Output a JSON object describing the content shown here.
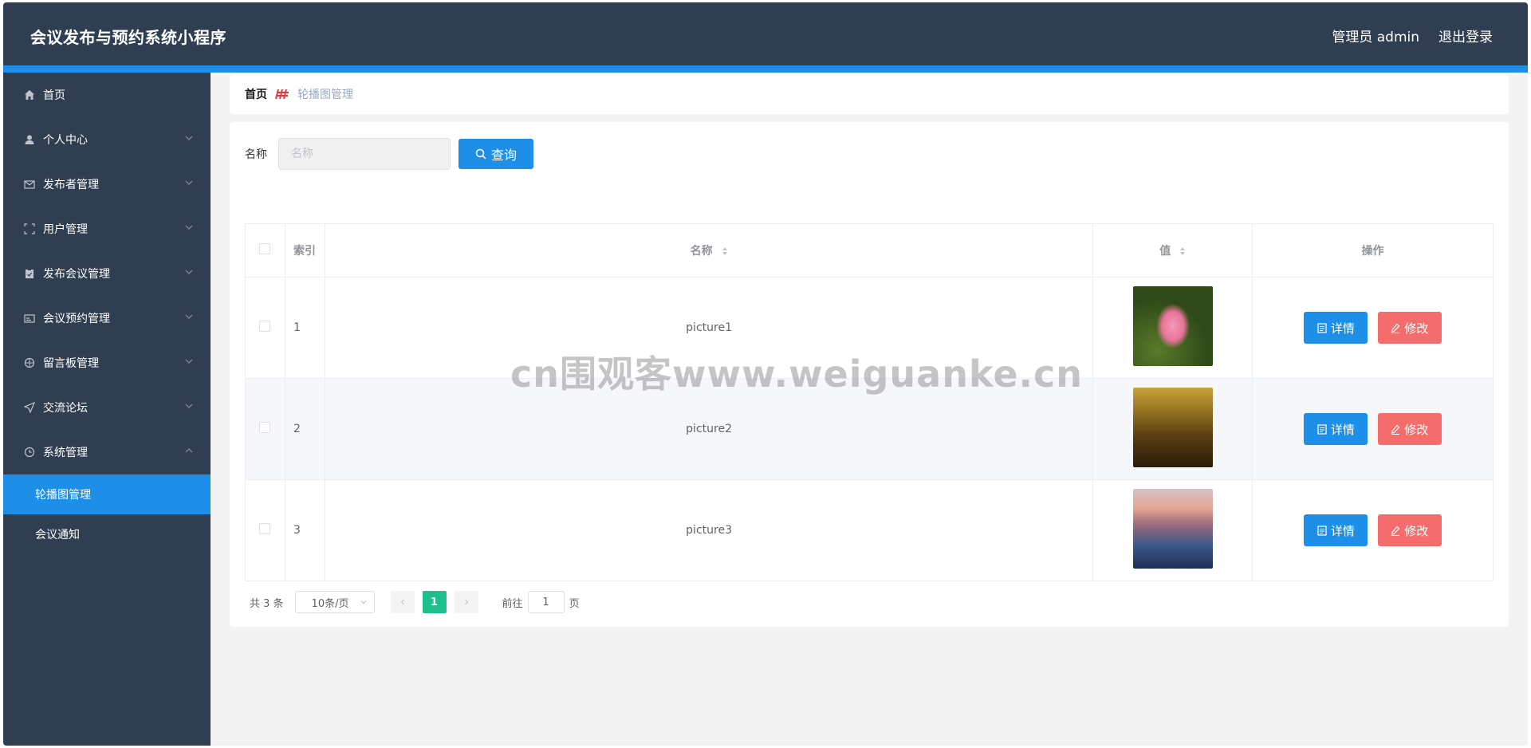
{
  "header": {
    "app_title": "会议发布与预约系统小程序",
    "user_label": "管理员 admin",
    "logout_label": "退出登录"
  },
  "sidebar": {
    "items": [
      {
        "label": "首页",
        "icon": "home-icon",
        "has_chevron": false
      },
      {
        "label": "个人中心",
        "icon": "user-icon",
        "has_chevron": true
      },
      {
        "label": "发布者管理",
        "icon": "mail-icon",
        "has_chevron": true
      },
      {
        "label": "用户管理",
        "icon": "fullscreen-icon",
        "has_chevron": true
      },
      {
        "label": "发布会议管理",
        "icon": "clipboard-icon",
        "has_chevron": true
      },
      {
        "label": "会议预约管理",
        "icon": "card-icon",
        "has_chevron": true
      },
      {
        "label": "留言板管理",
        "icon": "compass-icon",
        "has_chevron": true
      },
      {
        "label": "交流论坛",
        "icon": "send-icon",
        "has_chevron": true
      },
      {
        "label": "系统管理",
        "icon": "clock-icon",
        "has_chevron": true,
        "expanded": true
      }
    ],
    "submenu": [
      {
        "label": "轮播图管理",
        "active": true
      },
      {
        "label": "会议通知",
        "active": false
      }
    ]
  },
  "breadcrumb": {
    "home": "首页",
    "current": "轮播图管理"
  },
  "search": {
    "label": "名称",
    "placeholder": "名称",
    "button_label": "查询"
  },
  "table": {
    "headers": {
      "index": "索引",
      "name": "名称",
      "value": "值",
      "actions": "操作"
    },
    "rows": [
      {
        "index": "1",
        "name": "picture1",
        "image": "lotus flower"
      },
      {
        "index": "2",
        "name": "picture2",
        "image": "golden city night"
      },
      {
        "index": "3",
        "name": "picture3",
        "image": "coastal town dusk"
      }
    ],
    "detail_label": "详情",
    "edit_label": "修改"
  },
  "pagination": {
    "total": "共 3 条",
    "page_size": "10条/页",
    "current_page": "1",
    "goto_prefix": "前往",
    "goto_value": "1",
    "goto_suffix": "页"
  },
  "watermark": "cn围观客www.weiguanke.cn",
  "colors": {
    "header_bg": "#2f3e50",
    "accent": "#1e8fe8",
    "danger": "#f56c6c",
    "pager_active": "#1dc08a"
  }
}
